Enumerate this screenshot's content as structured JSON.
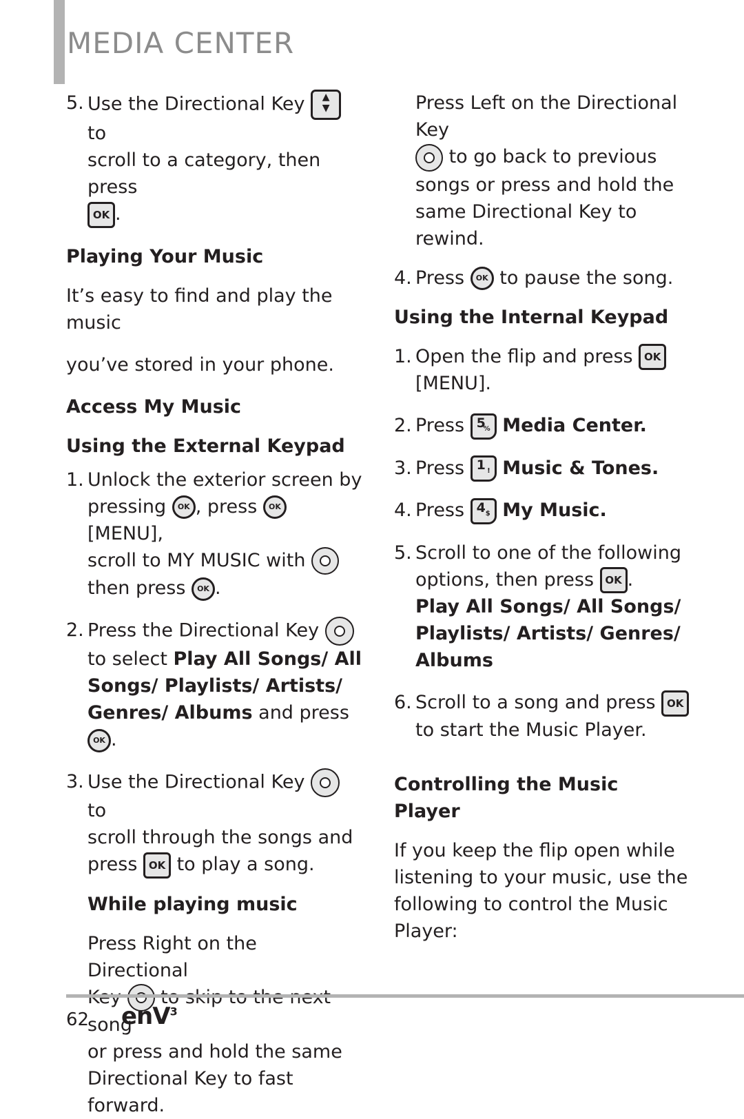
{
  "header": {
    "title": "MEDIA CENTER"
  },
  "left": {
    "step5_prev": {
      "num": "5.",
      "a": "Use the Directional Key",
      "b": "to",
      "c": "scroll to a category, then press",
      "d": "."
    },
    "playing_heading": "Playing Your Music",
    "intro_line1": "It’s easy to find and play the music",
    "intro_line2": "you’ve stored in your phone.",
    "access_heading": "Access My Music",
    "external_heading": "Using the External Keypad",
    "step1": {
      "num": "1.",
      "l1": "Unlock the exterior screen by",
      "l2a": "pressing",
      "l2b": ", press",
      "l2c": "[MENU],",
      "l3": "scroll to MY MUSIC with",
      "l4a": "then press",
      "l4b": "."
    },
    "step2": {
      "num": "2.",
      "l1": "Press the Directional Key",
      "l2a": "to select ",
      "l2b": "Play All Songs/ All",
      "l3": "Songs/ Playlists/ Artists/",
      "l4a": "Genres/ Albums",
      "l4b": " and press",
      "l4c": "."
    },
    "step3": {
      "num": "3.",
      "l1a": "Use the Directional Key",
      "l1b": "to",
      "l2": "scroll through the songs and",
      "l3a": "press",
      "l3b": "to play a song."
    },
    "while_heading": "While playing music",
    "while_l1": "Press Right on the Directional",
    "while_l2a": "Key",
    "while_l2b": "to skip to the next song",
    "while_l3": "or press and hold the same",
    "while_l4": "Directional Key to fast forward."
  },
  "right": {
    "left_l1": "Press Left on the Directional Key",
    "left_l2": "to go back to previous",
    "left_l3": "songs or press and hold the",
    "left_l4": "same Directional Key to rewind.",
    "step4_pause": {
      "num": "4.",
      "a": "Press",
      "b": "to pause the song."
    },
    "internal_heading": "Using the Internal Keypad",
    "istep1": {
      "num": "1.",
      "a": "Open the flip and press",
      "b": "[MENU]."
    },
    "istep2": {
      "num": "2.",
      "a": "Press",
      "key": "5",
      "key_sym": "%",
      "b": "Media Center."
    },
    "istep3": {
      "num": "3.",
      "a": "Press",
      "key": "1",
      "key_sym": "!",
      "b": "Music & Tones."
    },
    "istep4": {
      "num": "4.",
      "a": "Press",
      "key": "4",
      "key_sym": "$",
      "b": "My Music."
    },
    "istep5": {
      "num": "5.",
      "l1": "Scroll to one of the following",
      "l2a": "options, then press",
      "l2b": ".",
      "l3": "Play All Songs/ All Songs/",
      "l4": "Playlists/ Artists/ Genres/",
      "l5": "Albums"
    },
    "istep6": {
      "num": "6.",
      "l1": "Scroll to a song and press",
      "l2": "to start the Music Player."
    },
    "controlling_heading": "Controlling the Music Player",
    "ctrl_l1": "If you keep the flip open while",
    "ctrl_l2": "listening to your music, use the",
    "ctrl_l3": "following to control the Music",
    "ctrl_l4": "Player:"
  },
  "keys": {
    "ok": "OK",
    "up": "▲",
    "down": "▼",
    "left": "◂",
    "right": "▸"
  },
  "footer": {
    "page": "62",
    "brand": "enV",
    "brand_sup": "3"
  }
}
